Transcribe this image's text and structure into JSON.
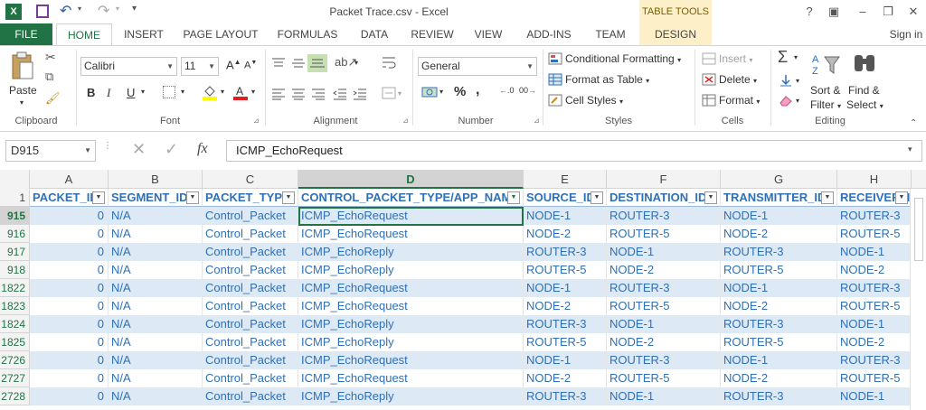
{
  "window": {
    "title": "Packet Trace.csv - Excel",
    "table_tools": "TABLE TOOLS",
    "help": "?",
    "signin": "Sign in"
  },
  "tabs": [
    "FILE",
    "HOME",
    "INSERT",
    "PAGE LAYOUT",
    "FORMULAS",
    "DATA",
    "REVIEW",
    "VIEW",
    "ADD-INS",
    "TEAM",
    "DESIGN"
  ],
  "ribbon": {
    "clipboard": {
      "paste": "Paste",
      "label": "Clipboard"
    },
    "font": {
      "name": "Calibri",
      "size": "11",
      "bold": "B",
      "italic": "I",
      "underline": "U",
      "grow": "A",
      "shrink": "A",
      "label": "Font"
    },
    "alignment": {
      "label": "Alignment"
    },
    "number": {
      "format": "General",
      "percent": "%",
      "comma": ",",
      "inc": ".0",
      "dec": "00",
      "label": "Number"
    },
    "styles": {
      "conditional": "Conditional Formatting",
      "format_table": "Format as Table",
      "cell_styles": "Cell Styles",
      "label": "Styles"
    },
    "cells": {
      "insert": "Insert",
      "delete": "Delete",
      "format": "Format",
      "label": "Cells"
    },
    "editing": {
      "sort": "Sort &",
      "filter": "Filter",
      "find": "Find &",
      "select": "Select",
      "label": "Editing",
      "sigma": "Σ"
    }
  },
  "formula_bar": {
    "name_box": "D915",
    "fx": "fx",
    "value": "ICMP_EchoRequest"
  },
  "columns": [
    "A",
    "B",
    "C",
    "D",
    "E",
    "F",
    "G",
    "H"
  ],
  "selected_column": "D",
  "header_row_number": "1",
  "headers": [
    "PACKET_ID",
    "SEGMENT_ID",
    "PACKET_TYPE",
    "CONTROL_PACKET_TYPE/APP_NAME",
    "SOURCE_ID",
    "DESTINATION_ID",
    "TRANSMITTER_ID",
    "RECEIVER_ID"
  ],
  "rows": [
    {
      "n": "915",
      "cells": [
        "0",
        "N/A",
        "Control_Packet",
        "ICMP_EchoRequest",
        "NODE-1",
        "ROUTER-3",
        "NODE-1",
        "ROUTER-3"
      ]
    },
    {
      "n": "916",
      "cells": [
        "0",
        "N/A",
        "Control_Packet",
        "ICMP_EchoRequest",
        "NODE-2",
        "ROUTER-5",
        "NODE-2",
        "ROUTER-5"
      ]
    },
    {
      "n": "917",
      "cells": [
        "0",
        "N/A",
        "Control_Packet",
        "ICMP_EchoReply",
        "ROUTER-3",
        "NODE-1",
        "ROUTER-3",
        "NODE-1"
      ]
    },
    {
      "n": "918",
      "cells": [
        "0",
        "N/A",
        "Control_Packet",
        "ICMP_EchoReply",
        "ROUTER-5",
        "NODE-2",
        "ROUTER-5",
        "NODE-2"
      ]
    },
    {
      "n": "1822",
      "cells": [
        "0",
        "N/A",
        "Control_Packet",
        "ICMP_EchoRequest",
        "NODE-1",
        "ROUTER-3",
        "NODE-1",
        "ROUTER-3"
      ]
    },
    {
      "n": "1823",
      "cells": [
        "0",
        "N/A",
        "Control_Packet",
        "ICMP_EchoRequest",
        "NODE-2",
        "ROUTER-5",
        "NODE-2",
        "ROUTER-5"
      ]
    },
    {
      "n": "1824",
      "cells": [
        "0",
        "N/A",
        "Control_Packet",
        "ICMP_EchoReply",
        "ROUTER-3",
        "NODE-1",
        "ROUTER-3",
        "NODE-1"
      ]
    },
    {
      "n": "1825",
      "cells": [
        "0",
        "N/A",
        "Control_Packet",
        "ICMP_EchoReply",
        "ROUTER-5",
        "NODE-2",
        "ROUTER-5",
        "NODE-2"
      ]
    },
    {
      "n": "2726",
      "cells": [
        "0",
        "N/A",
        "Control_Packet",
        "ICMP_EchoRequest",
        "NODE-1",
        "ROUTER-3",
        "NODE-1",
        "ROUTER-3"
      ]
    },
    {
      "n": "2727",
      "cells": [
        "0",
        "N/A",
        "Control_Packet",
        "ICMP_EchoRequest",
        "NODE-2",
        "ROUTER-5",
        "NODE-2",
        "ROUTER-5"
      ]
    },
    {
      "n": "2728",
      "cells": [
        "0",
        "N/A",
        "Control_Packet",
        "ICMP_EchoReply",
        "ROUTER-3",
        "NODE-1",
        "ROUTER-3",
        "NODE-1"
      ]
    }
  ],
  "active_cell": {
    "row": "915",
    "column": "D"
  },
  "colors": {
    "excel_green": "#217346",
    "cell_text": "#2f70b6",
    "band": "#dde9f5",
    "table_tools_bg": "#fdf0c8"
  }
}
